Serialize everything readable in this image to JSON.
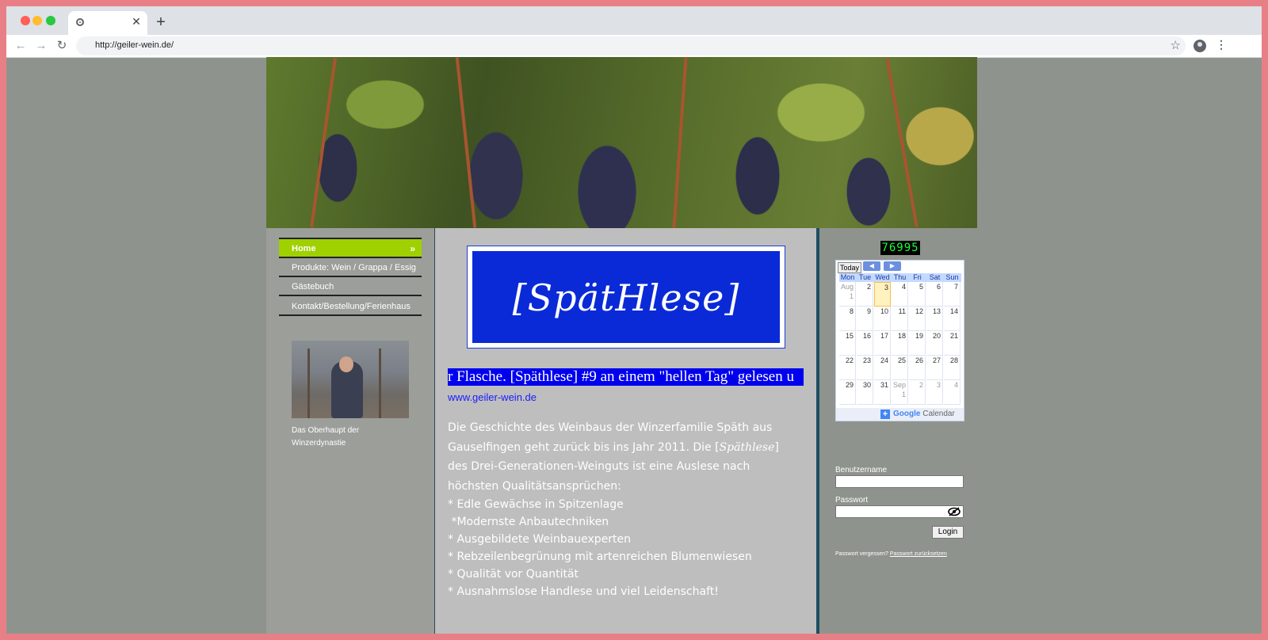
{
  "browser": {
    "url": "http://geiler-wein.de/",
    "tab_close": "✕",
    "new_tab": "+"
  },
  "menu": {
    "items": [
      {
        "label": "Home",
        "active": true
      },
      {
        "label": "Produkte: Wein / Grappa / Essig"
      },
      {
        "label": "Gästebuch"
      },
      {
        "label": "Kontakt/Bestellung/Ferienhaus"
      }
    ]
  },
  "sidebar": {
    "caption": "Das Oberhaupt der Winzerdynastie"
  },
  "content": {
    "logo_text": "[SpätHlese]",
    "ticker": "r Flasche. [Späthlese] #9 an einem \"hellen Tag\" gelesen u",
    "link": "www.geiler-wein.de",
    "story_intro_1": "Die Geschichte des Weinbaus der Winzerfamilie Späth aus Gauselfingen geht zurück bis ins Jahr 2011. Die [",
    "story_brand": "Späthlese",
    "story_intro_2": "] des Drei-Generationen-Weinguts ist eine Auslese nach höchsten Qualitätsansprüchen:",
    "bullets": [
      "* Edle Gewächse in Spitzenlage",
      " *Modernste Anbautechniken",
      "* Ausgebildete Weinbauexperten",
      "* Rebzeilenbegrünung mit artenreichen Blumenwiesen",
      "* Qualität vor Quantität",
      "* Ausnahmslose Handlese und viel Leidenschaft!"
    ]
  },
  "right": {
    "counter": "76995",
    "calendar": {
      "today_label": "Today",
      "prev": "◀",
      "next": "▶",
      "days": [
        "Mon",
        "Tue",
        "Wed",
        "Thu",
        "Fri",
        "Sat",
        "Sun"
      ],
      "weeks": [
        [
          "Aug 1",
          "2",
          "3",
          "4",
          "5",
          "6",
          "7"
        ],
        [
          "8",
          "9",
          "10",
          "11",
          "12",
          "13",
          "14"
        ],
        [
          "15",
          "16",
          "17",
          "18",
          "19",
          "20",
          "21"
        ],
        [
          "22",
          "23",
          "24",
          "25",
          "26",
          "27",
          "28"
        ],
        [
          "29",
          "30",
          "31",
          "Sep 1",
          "2",
          "3",
          "4"
        ]
      ],
      "footer_plus": "+",
      "footer_google": "Google",
      "footer_calendar": "Calendar"
    },
    "username_label": "Benutzername",
    "password_label": "Passwort",
    "login": "Login",
    "forgot_text": "Passwort vergessen?",
    "reset_link": "Passwort zurücksetzen"
  },
  "colors": {
    "menu_active": "#9fd000",
    "logo_blue": "#0a2ad8",
    "ticker_blue": "#0000ee",
    "divider": "#1d4f62"
  }
}
